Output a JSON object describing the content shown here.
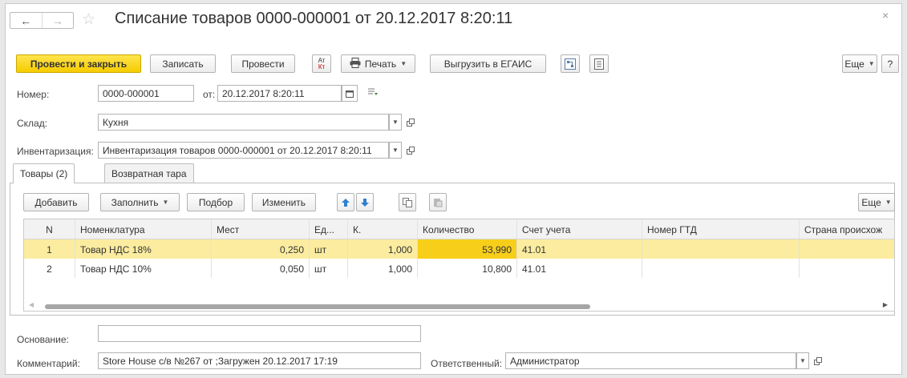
{
  "window": {
    "title": "Списание товаров 0000-000001 от 20.12.2017 8:20:11",
    "back": "←",
    "forward": "→",
    "star": "☆",
    "close": "×"
  },
  "toolbar": {
    "post_close": "Провести и закрыть",
    "save": "Записать",
    "post": "Провести",
    "dtkt_top": "Ат",
    "dtkt_bottom": "Кт",
    "print": "Печать",
    "export": "Выгрузить в ЕГАИС",
    "more": "Еще",
    "help": "?"
  },
  "form": {
    "number_label": "Номер:",
    "number_value": "0000-000001",
    "date_label": "от:",
    "date_value": "20.12.2017  8:20:11",
    "warehouse_label": "Склад:",
    "warehouse_value": "Кухня",
    "inventory_label": "Инвентаризация:",
    "inventory_value": "Инвентаризация товаров 0000-000001 от 20.12.2017 8:20:11",
    "basis_label": "Основание:",
    "basis_value": "",
    "comment_label": "Комментарий:",
    "comment_value": "Store House с/в №267 от ;Загружен 20.12.2017 17:19",
    "responsible_label": "Ответственный:",
    "responsible_value": "Администратор"
  },
  "tabs": [
    {
      "label": "Товары (2)"
    },
    {
      "label": "Возвратная тара"
    }
  ],
  "table_toolbar": {
    "add": "Добавить",
    "fill": "Заполнить",
    "select": "Подбор",
    "change": "Изменить",
    "more": "Еще"
  },
  "table": {
    "columns": [
      "N",
      "Номенклатура",
      "Мест",
      "Ед...",
      "К.",
      "Количество",
      "Счет учета",
      "Номер ГТД",
      "Страна происхож"
    ],
    "rows": [
      {
        "n": "1",
        "name": "Товар НДС 18%",
        "places": "0,250",
        "unit": "шт",
        "k": "1,000",
        "qty": "53,990",
        "account": "41.01",
        "gtd": "",
        "country": ""
      },
      {
        "n": "2",
        "name": "Товар НДС 10%",
        "places": "0,050",
        "unit": "шт",
        "k": "1,000",
        "qty": "10,800",
        "account": "41.01",
        "gtd": "",
        "country": ""
      }
    ]
  },
  "colors": {
    "primary": "#f5cc00",
    "selected_row": "#fbec9f",
    "selected_cell": "#f7cf1a"
  }
}
